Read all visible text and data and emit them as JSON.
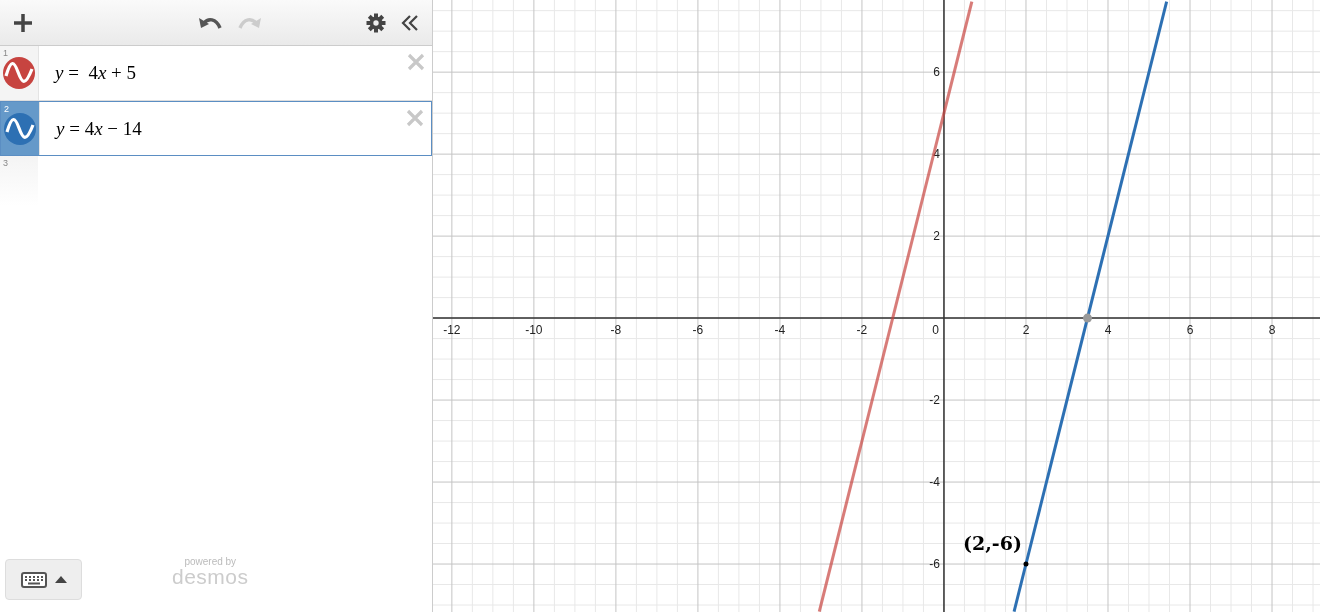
{
  "toolbar": {
    "undo": {
      "disabled": false
    },
    "redo": {
      "disabled": true
    }
  },
  "expressions": [
    {
      "number": "1",
      "latex": "y =  4x + 5",
      "color": "#c74440",
      "selected": false
    },
    {
      "number": "2",
      "latex": "y = 4x − 14",
      "color": "#2d70b3",
      "selected": true
    },
    {
      "number": "3"
    }
  ],
  "footer": {
    "powered_by": "powered by",
    "brand": "desmos"
  },
  "graph": {
    "origin_label": "0",
    "chart_data": {
      "type": "line",
      "grid": true,
      "x": [
        -3.04,
        0.68,
        1.71,
        5.43
      ],
      "series": [
        {
          "color": "#c74440",
          "values": [
            -7.16,
            7.72,
            null,
            null
          ]
        },
        {
          "color": "#2d70b3",
          "values": [
            null,
            null,
            -7.16,
            7.72
          ]
        }
      ],
      "xlim": [
        -12.46,
        9.17
      ],
      "ylim": [
        -7.17,
        7.76
      ],
      "xticks": [
        {
          "value": -12,
          "label": "-12"
        },
        {
          "value": -10,
          "label": "-10"
        },
        {
          "value": -8,
          "label": "-8"
        },
        {
          "value": -6,
          "label": "-6"
        },
        {
          "value": -4,
          "label": "-4"
        },
        {
          "value": -2,
          "label": "-2"
        },
        {
          "value": 2,
          "label": "2"
        },
        {
          "value": 4,
          "label": "4"
        },
        {
          "value": 6,
          "label": "6"
        },
        {
          "value": 8,
          "label": "8"
        }
      ],
      "yticks": [
        {
          "value": -6,
          "label": "-6"
        },
        {
          "value": -4,
          "label": "-4"
        },
        {
          "value": -2,
          "label": "-2"
        },
        {
          "value": 2,
          "label": "2"
        },
        {
          "value": 4,
          "label": "4"
        },
        {
          "value": 6,
          "label": "6"
        }
      ],
      "annotations": [
        {
          "text": "(2,-6)",
          "x": 2,
          "y": -6
        }
      ]
    }
  }
}
